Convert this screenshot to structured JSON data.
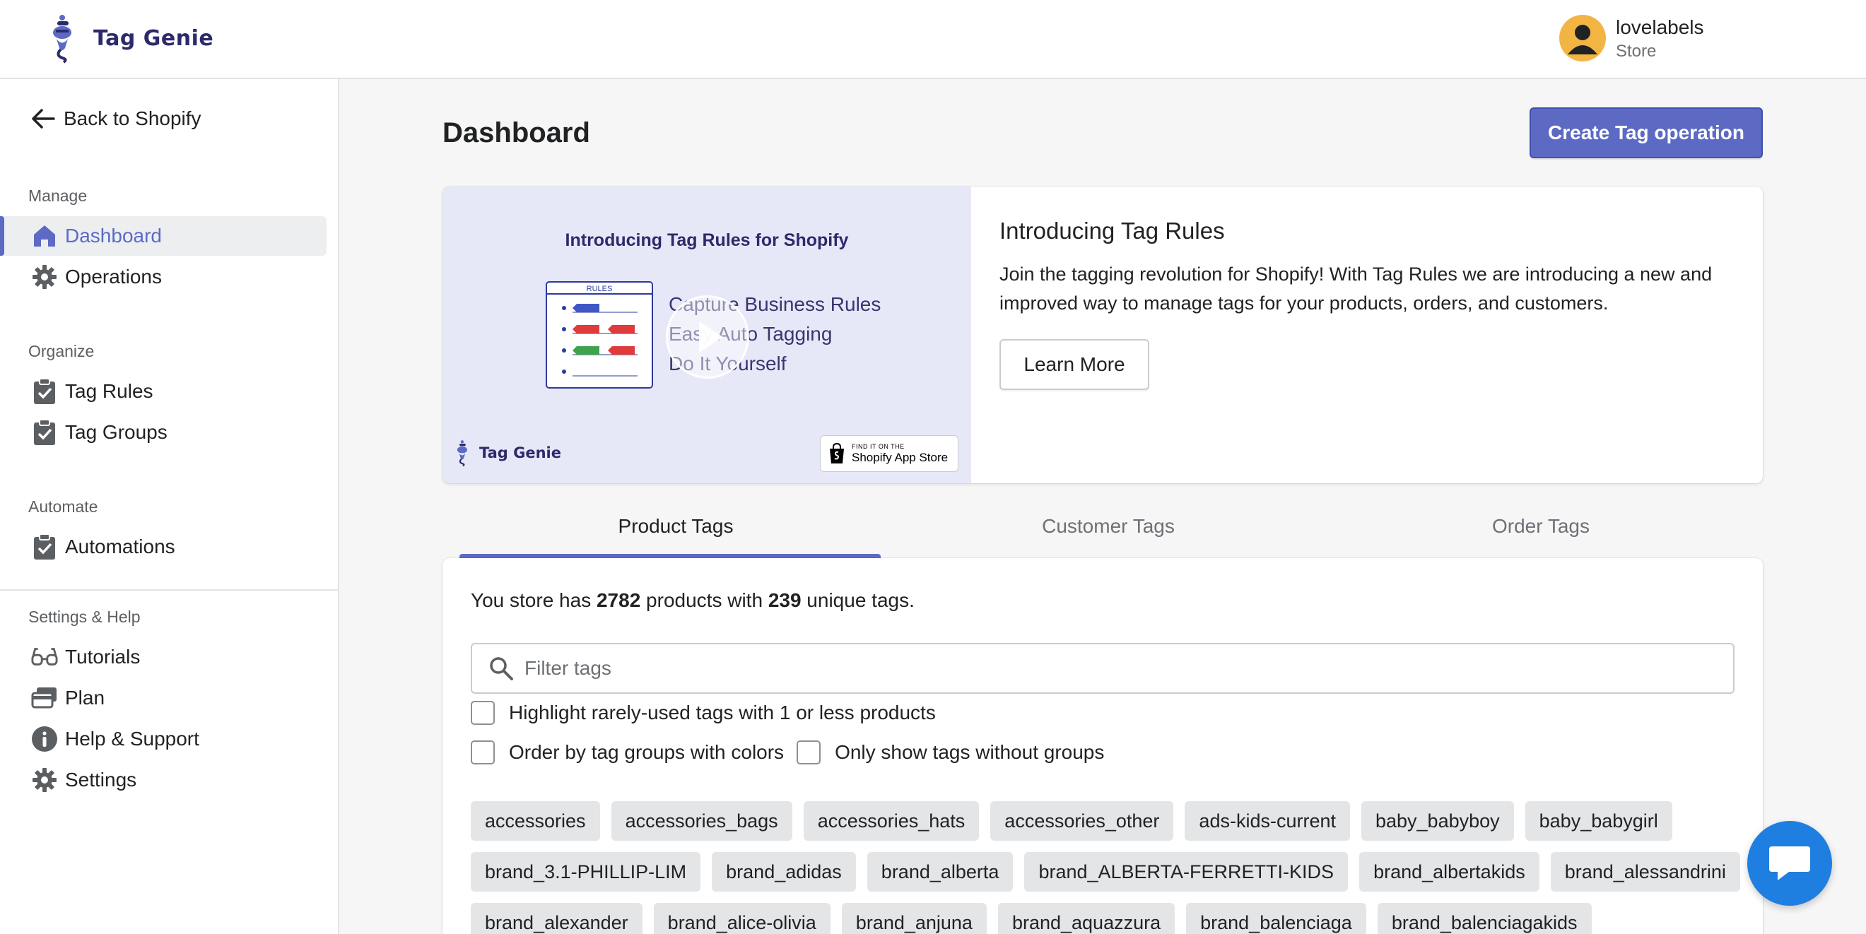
{
  "app": {
    "name": "Tag Genie"
  },
  "user": {
    "name": "lovelabels",
    "role": "Store"
  },
  "sidebar": {
    "back": "Back to Shopify",
    "sections": {
      "manage": "Manage",
      "organize": "Organize",
      "automate": "Automate",
      "settings_help": "Settings & Help"
    },
    "items": {
      "dashboard": "Dashboard",
      "operations": "Operations",
      "tag_rules": "Tag Rules",
      "tag_groups": "Tag Groups",
      "automations": "Automations",
      "tutorials": "Tutorials",
      "plan": "Plan",
      "help_support": "Help & Support",
      "settings": "Settings"
    },
    "active": "dashboard"
  },
  "page": {
    "title": "Dashboard",
    "primary_action": "Create Tag operation"
  },
  "promo": {
    "video": {
      "title": "Introducing Tag Rules for Shopify",
      "doc_label": "RULES",
      "bullets": [
        "Capture Business Rules",
        "Easy Auto Tagging",
        "Do It Yourself"
      ],
      "brand": "Tag Genie",
      "badge_small": "FIND IT ON THE",
      "badge_big": "Shopify App Store"
    },
    "heading": "Introducing Tag Rules",
    "text": "Join the tagging revolution for Shopify! With Tag Rules we are introducing a new and improved way to manage tags for your products, orders, and customers.",
    "button": "Learn More"
  },
  "tabs": [
    "Product Tags",
    "Customer Tags",
    "Order Tags"
  ],
  "active_tab": 0,
  "tags_panel": {
    "summary_prefix": "You store has ",
    "products_count": "2782",
    "summary_mid": " products with ",
    "unique_tags": "239",
    "summary_suffix": " unique tags.",
    "filter_placeholder": "Filter tags",
    "checkbox_rarely": "Highlight rarely-used tags with 1 or less products",
    "checkbox_order_groups": "Order by tag groups with colors",
    "checkbox_no_groups": "Only show tags without groups",
    "tags": [
      "accessories",
      "accessories_bags",
      "accessories_hats",
      "accessories_other",
      "ads-kids-current",
      "baby_babyboy",
      "baby_babygirl",
      "brand_3.1-PHILLIP-LIM",
      "brand_adidas",
      "brand_alberta",
      "brand_ALBERTA-FERRETTI-KIDS",
      "brand_albertakids",
      "brand_alessandrini",
      "brand_alexander",
      "brand_alice-olivia",
      "brand_anjuna",
      "brand_aquazzura",
      "brand_balenciaga",
      "brand_balenciagakids"
    ]
  },
  "colors": {
    "accent": "#5c6ac4",
    "chat": "#1f7fe0",
    "avatar": "#f2b544"
  }
}
